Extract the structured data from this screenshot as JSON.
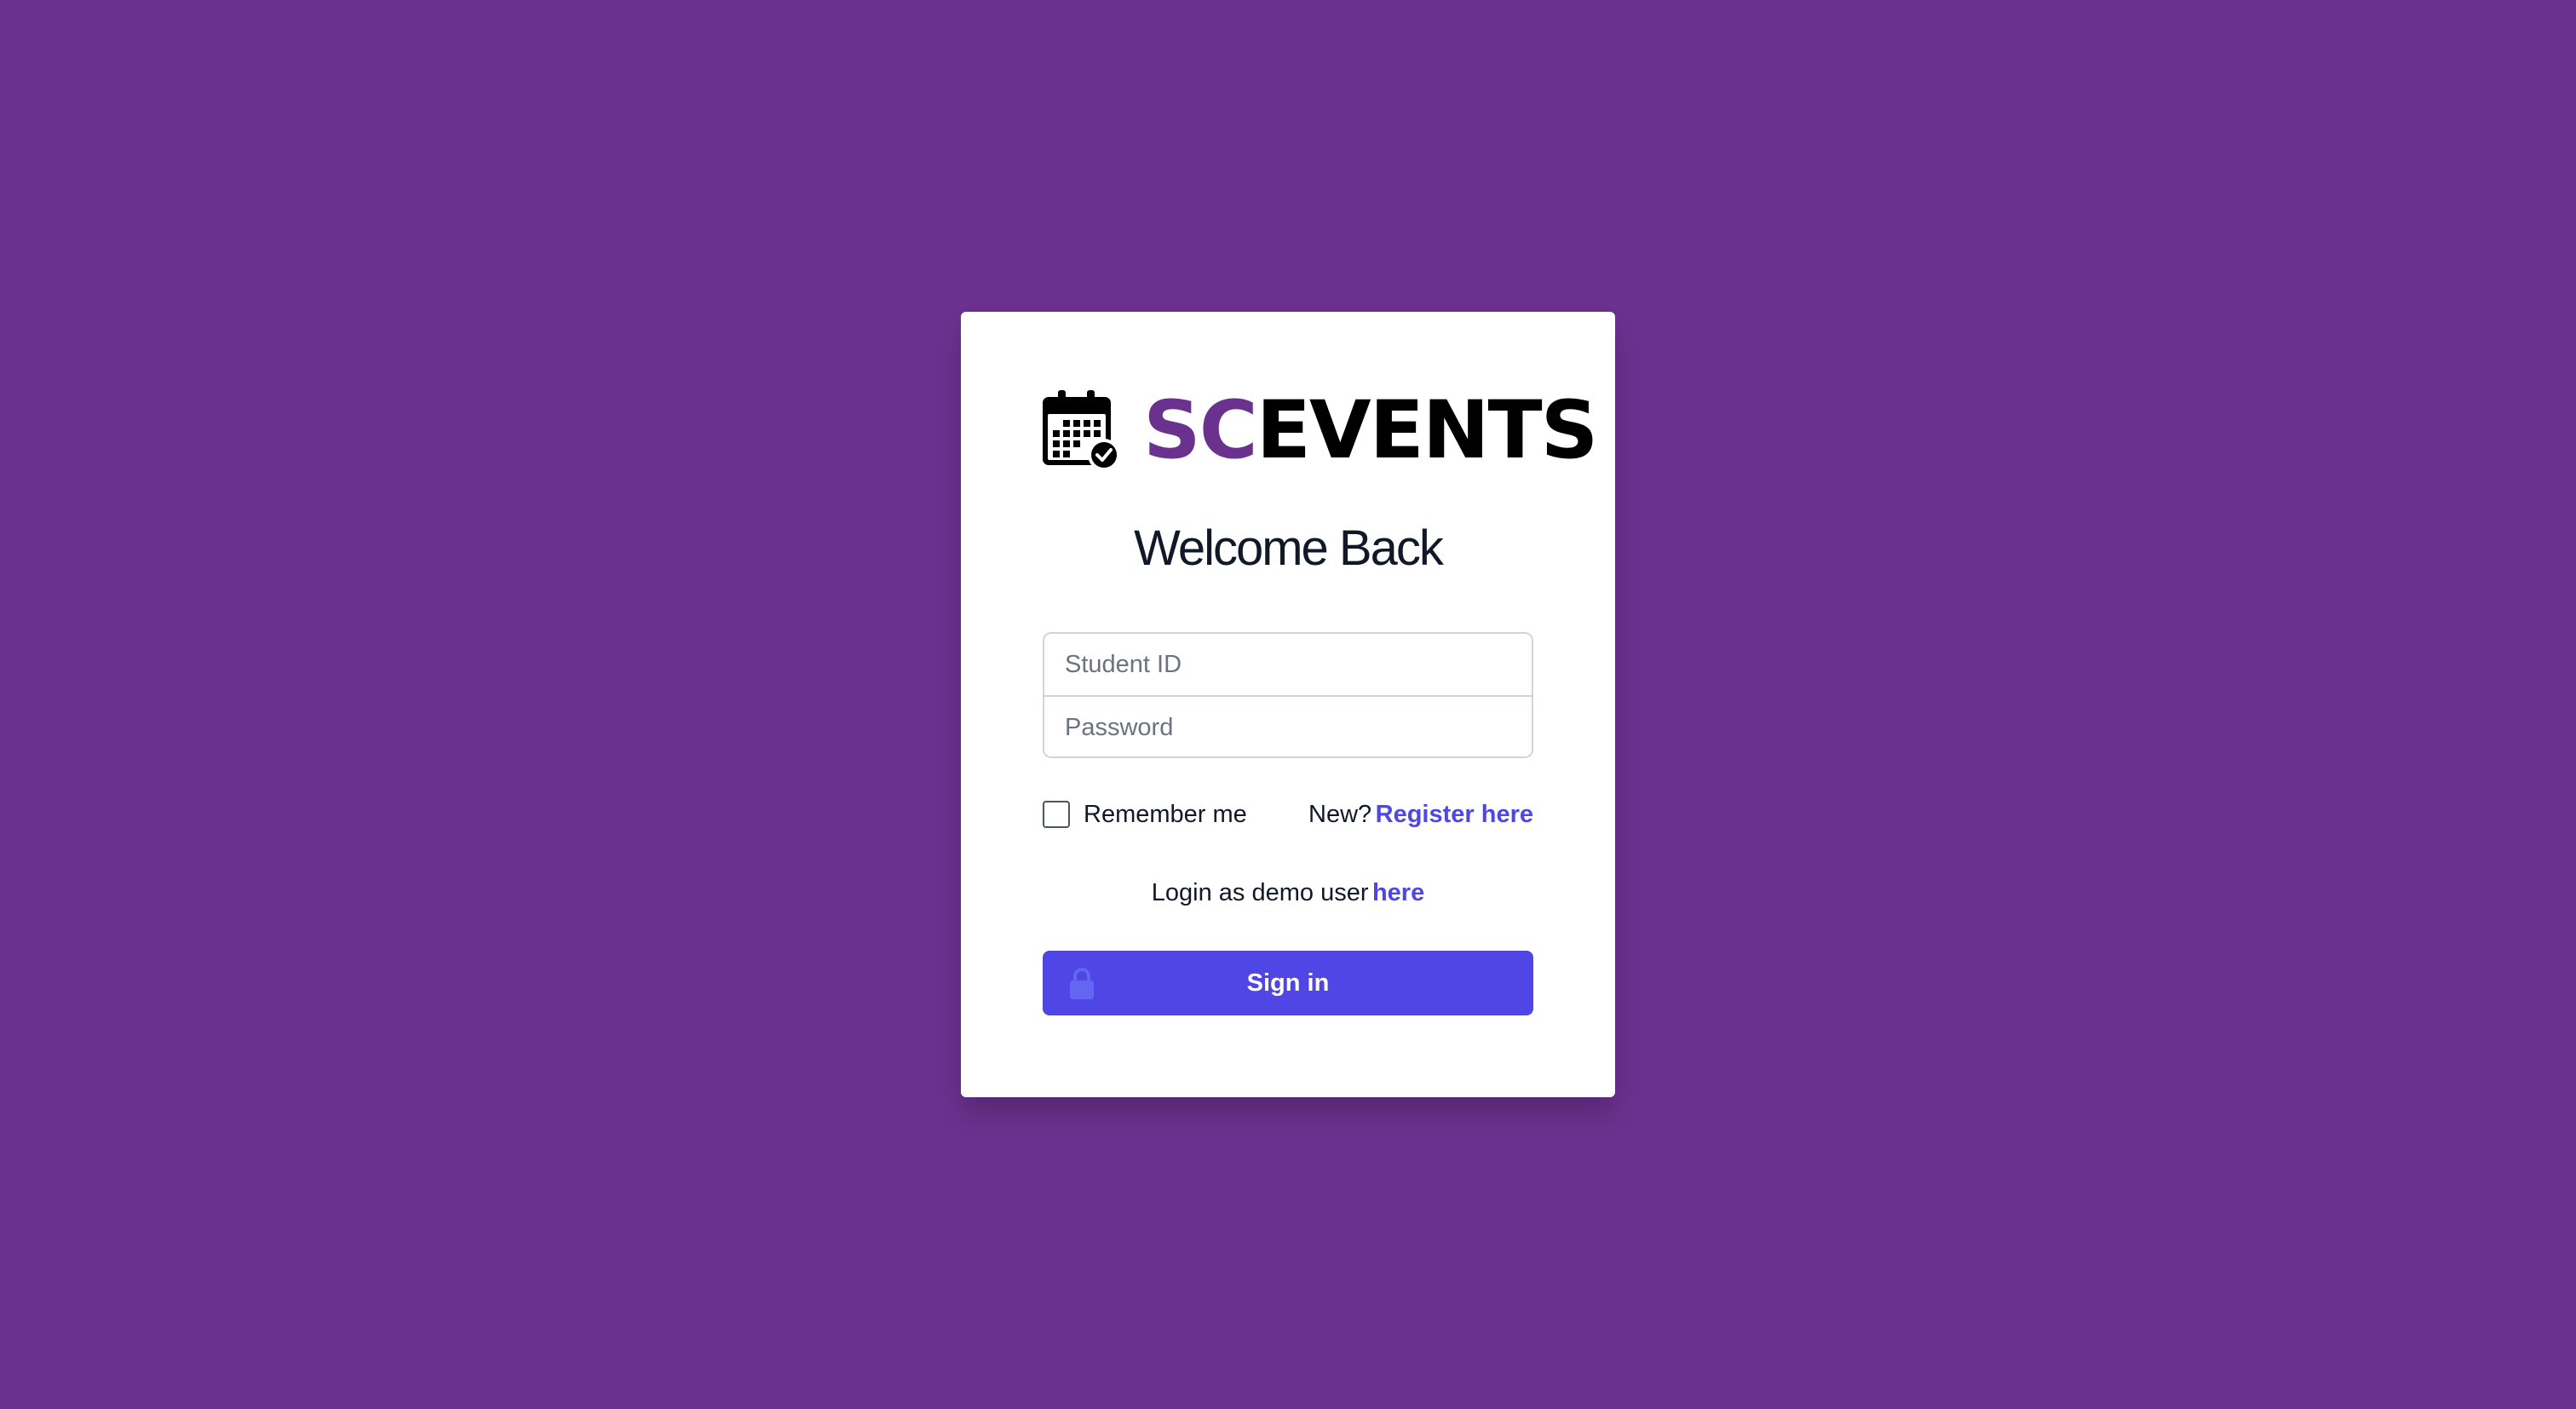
{
  "brand": {
    "name_part1": "SC",
    "name_part2": "EVENTS",
    "icon": "calendar-check-icon",
    "accent_color": "#6b318f"
  },
  "page": {
    "background_color": "#6b318f",
    "title": "Welcome Back"
  },
  "form": {
    "student_id": {
      "placeholder": "Student ID",
      "value": ""
    },
    "password": {
      "placeholder": "Password",
      "value": ""
    },
    "remember_label": "Remember me",
    "remember_checked": false,
    "new_prefix": "New?",
    "register_link": "Register here",
    "demo_prefix": "Login as demo user",
    "demo_link": "here",
    "signin_label": "Sign in",
    "signin_icon": "lock-icon",
    "primary_color": "#4f46e5"
  }
}
